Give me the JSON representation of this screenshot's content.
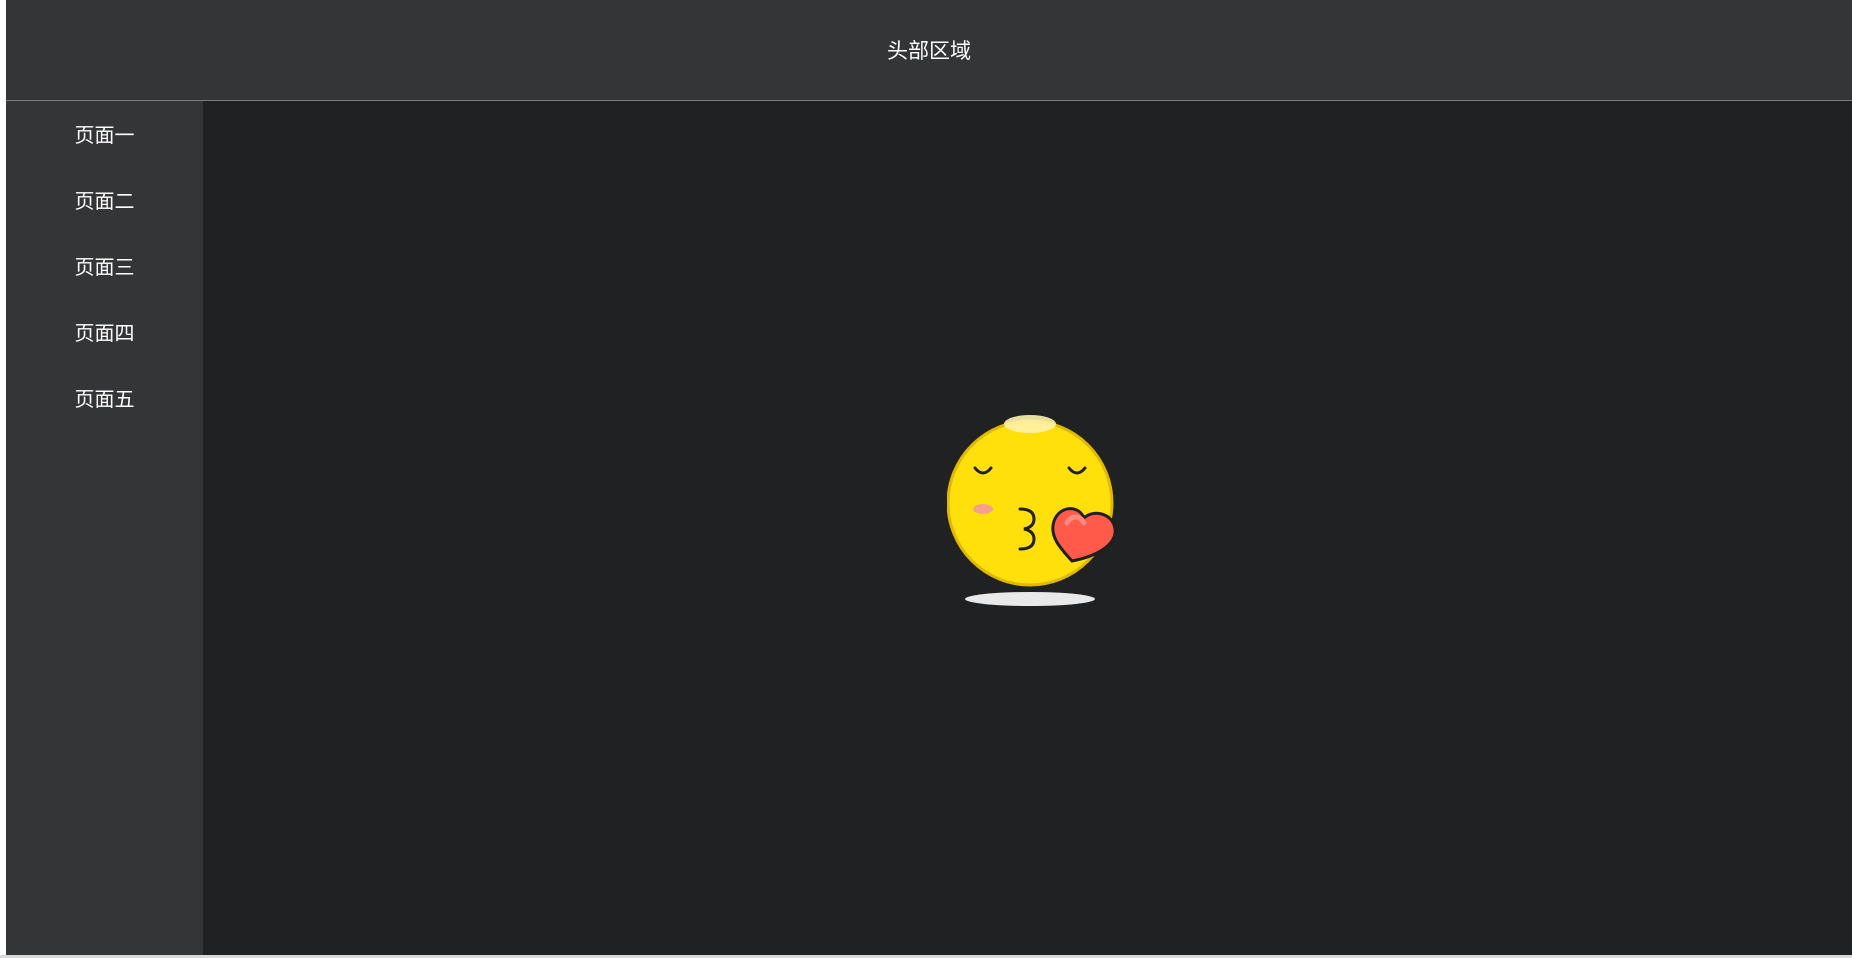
{
  "header": {
    "title": "头部区域"
  },
  "sidebar": {
    "items": [
      {
        "label": "页面一"
      },
      {
        "label": "页面二"
      },
      {
        "label": "页面三"
      },
      {
        "label": "页面四"
      },
      {
        "label": "页面五"
      }
    ]
  },
  "main": {
    "illustration": "kissing-face-with-heart-icon"
  },
  "colors": {
    "background": "#202123",
    "panel": "#343537",
    "face": "#ffe00a",
    "heart": "#ff5a4a",
    "text": "#ffffff"
  }
}
